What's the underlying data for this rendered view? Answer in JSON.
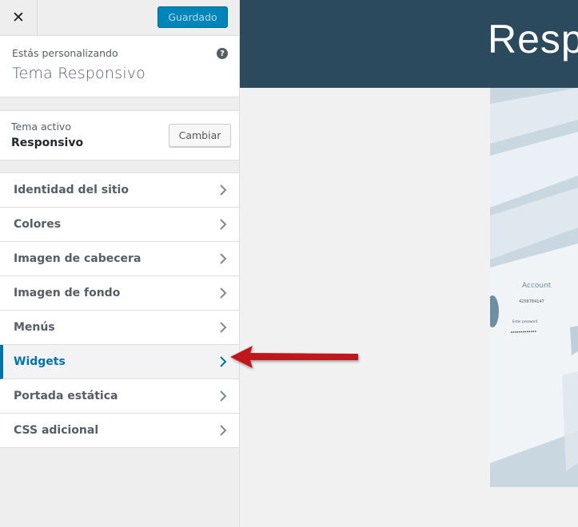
{
  "topbar": {
    "close_glyph": "✕",
    "save_label": "Guardado"
  },
  "customizing": {
    "label": "Estás personalizando",
    "theme_title": "Tema Responsivo",
    "help_glyph": "?"
  },
  "active_theme": {
    "label": "Tema activo",
    "name": "Responsivo",
    "change_label": "Cambiar"
  },
  "sections": [
    {
      "label": "Identidad del sitio",
      "active": false
    },
    {
      "label": "Colores",
      "active": false
    },
    {
      "label": "Imagen de cabecera",
      "active": false
    },
    {
      "label": "Imagen de fondo",
      "active": false
    },
    {
      "label": "Menús",
      "active": false
    },
    {
      "label": "Widgets",
      "active": true
    },
    {
      "label": "Portada estática",
      "active": false
    },
    {
      "label": "CSS adicional",
      "active": false
    }
  ],
  "preview": {
    "site_title": "Responsivo",
    "hero_texts": {
      "account": "Account",
      "number": "4258784147",
      "pass_label": "Enter password"
    }
  },
  "colors": {
    "accent": "#0073aa",
    "save_button": "#0085ba",
    "header_bg": "#2c4a5e",
    "annotation_arrow": "#c0181c"
  },
  "icons": {
    "close": "close-icon",
    "help": "help-icon",
    "section_chevron": "chevron-right-icon",
    "annotation": "red-arrow-icon"
  }
}
